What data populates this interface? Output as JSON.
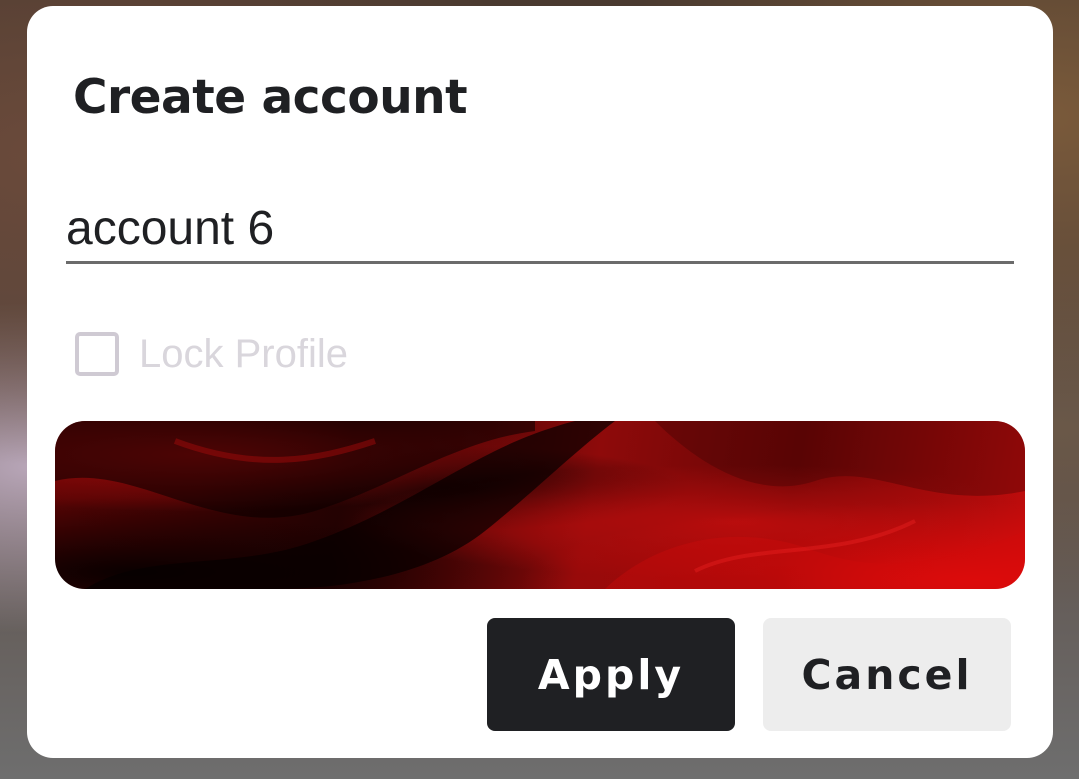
{
  "dialog": {
    "title": "Create account",
    "name_field": {
      "value": "account 6",
      "placeholder": ""
    },
    "lock_profile": {
      "label": "Lock Profile",
      "checked": false,
      "enabled": false
    },
    "banner": {
      "description_colors": [
        "#e20b0b",
        "#1a0202",
        "#8e0a0a"
      ]
    },
    "buttons": {
      "apply_label": "Apply",
      "cancel_label": "Cancel"
    }
  },
  "colors": {
    "primary_button": "#1f2023",
    "secondary_button": "#ededed",
    "disabled_text": "#d9d6dc"
  }
}
